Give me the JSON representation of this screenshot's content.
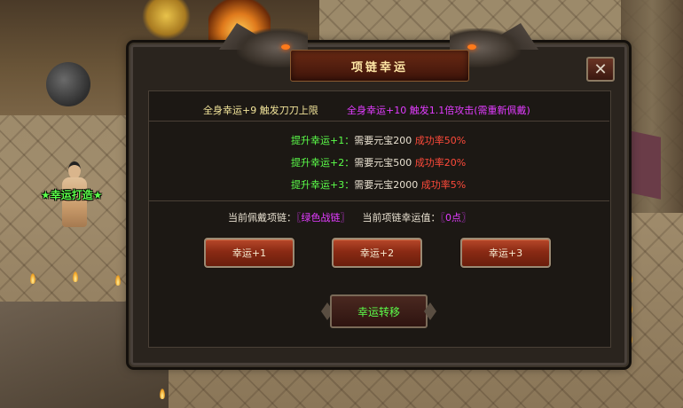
{
  "npc": {
    "name": "★幸运打造★"
  },
  "dialog": {
    "title": "项链幸运",
    "close_icon": "close-x-icon",
    "info": {
      "left": "全身幸运+9 触发刀刀上限",
      "right": "全身幸运+10 触发1.1倍攻击(需重新佩戴)"
    },
    "upgrades": [
      {
        "label": "提升幸运+1：",
        "cost": "需要元宝200",
        "rate": "成功率50%"
      },
      {
        "label": "提升幸运+2：",
        "cost": "需要元宝500",
        "rate": "成功率20%"
      },
      {
        "label": "提升幸运+3：",
        "cost": "需要元宝2000",
        "rate": "成功率5%"
      }
    ],
    "current": {
      "necklace_label": "当前佩戴项链：",
      "necklace_value": "〖绿色战链〗",
      "luck_label": "当前项链幸运值：",
      "luck_value": "〖0点〗"
    },
    "buttons": [
      "幸运+1",
      "幸运+2",
      "幸运+3"
    ],
    "transfer_button": "幸运转移"
  },
  "colors": {
    "title": "#ffe7a6",
    "yellow_text": "#f2e49a",
    "magenta_text": "#e23cff",
    "green_text": "#5cff4a",
    "red_text": "#ff4a3a"
  }
}
